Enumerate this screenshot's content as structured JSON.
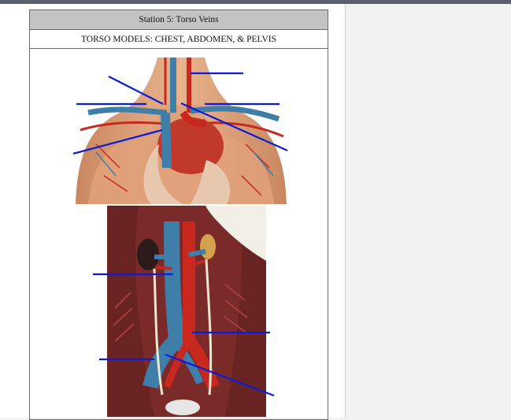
{
  "document": {
    "title": "Station 5: Torso Veins",
    "subtitle": "TORSO MODELS: CHEST, ABDOMEN, & PELVIS"
  },
  "figures": {
    "chest": {
      "label": "chest-model-image"
    },
    "abdomen": {
      "label": "abdomen-pelvis-model-image"
    }
  },
  "colors": {
    "pointer": "#0a1cd6",
    "vein": "#3f7ea8",
    "artery": "#c8281e",
    "skin": "#d99a72",
    "muscle": "#8c2e2c"
  }
}
